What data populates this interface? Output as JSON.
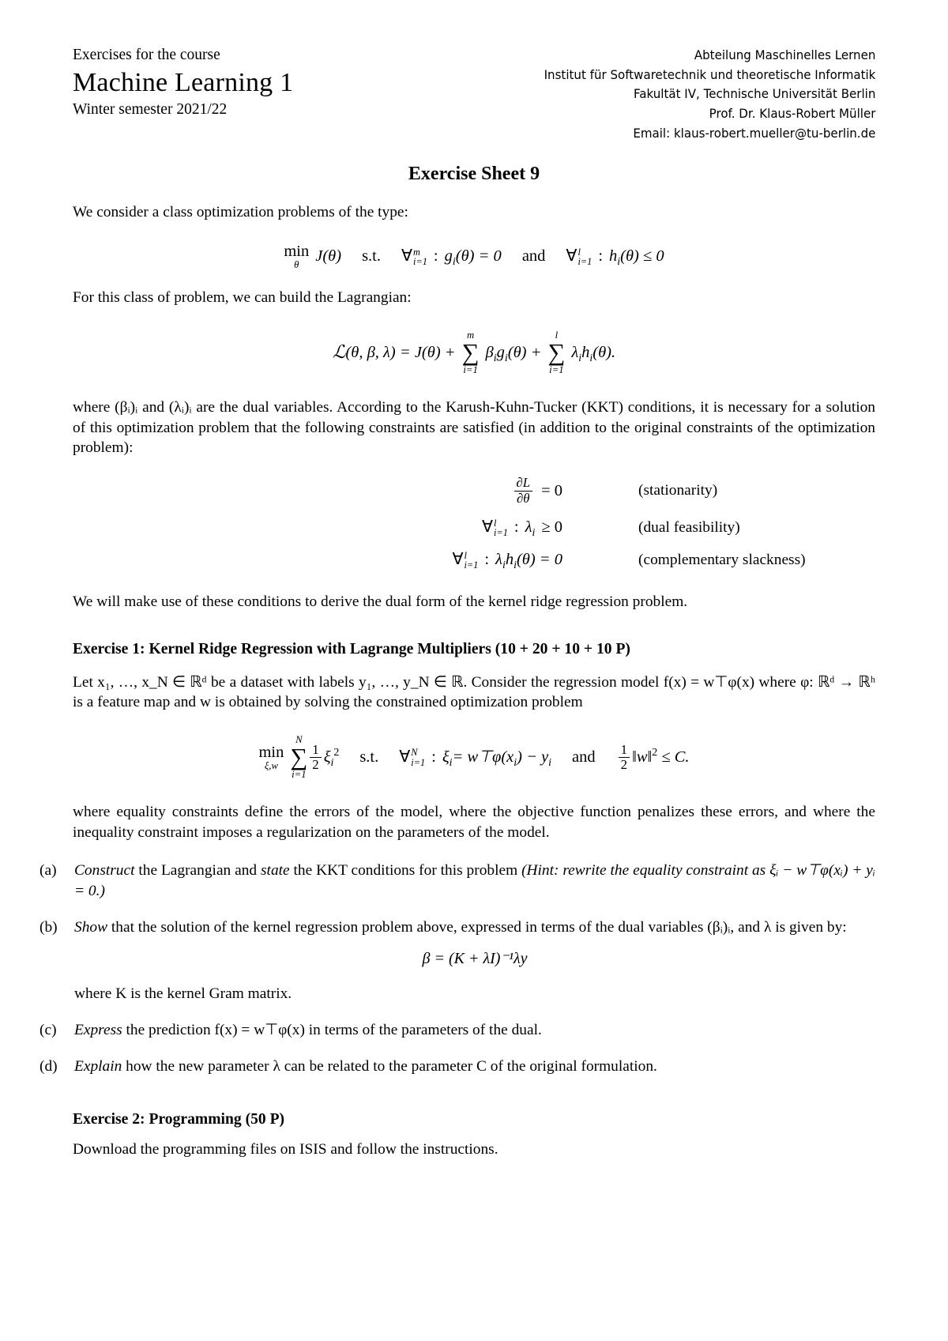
{
  "header": {
    "left": {
      "line1": "Exercises for the course",
      "line2": "Machine Learning 1",
      "line3": "Winter semester 2021/22"
    },
    "right": [
      "Abteilung Maschinelles Lernen",
      "Institut für Softwaretechnik und theoretische Informatik",
      "Fakultät IV, Technische Universität Berlin",
      "Prof. Dr. Klaus-Robert Müller",
      "Email: klaus-robert.mueller@tu-berlin.de"
    ]
  },
  "title": "Exercise Sheet 9",
  "intro": {
    "p1": "We consider a class optimization problems of the type:",
    "eq1": {
      "min": "min",
      "min_sub": "θ",
      "obj": "J(θ)",
      "st": "s.t.",
      "forall1_sup": "m",
      "forall1_sub": "i=1",
      "c1": "g",
      "c1_sub": "i",
      "c1_rest": "(θ) = 0",
      "and": "and",
      "forall2_sup": "l",
      "forall2_sub": "i=1",
      "c2": "h",
      "c2_sub": "i",
      "c2_rest": "(θ) ≤ 0"
    },
    "p2": "For this class of problem, we can build the Lagrangian:",
    "eq2": {
      "lhs": "(θ, β, λ) = J(θ) +",
      "sum1_top": "m",
      "sum1_bot": "i=1",
      "term1": "β",
      "term1_sub": "i",
      "term1_mid": "g",
      "term1_sub2": "i",
      "term1_rest": "(θ) +",
      "sum2_top": "l",
      "sum2_bot": "i=1",
      "term2": "λ",
      "term2_sub": "i",
      "term2_mid": "h",
      "term2_sub2": "i",
      "term2_rest": "(θ)."
    },
    "p3": "where (βᵢ)ᵢ and (λᵢ)ᵢ are the dual variables. According to the Karush-Kuhn-Tucker (KKT) conditions, it is necessary for a solution of this optimization problem that the following constraints are satisfied (in addition to the original constraints of the optimization problem):",
    "kkt": [
      {
        "lhs_type": "frac",
        "num": "∂",
        "num_it": "L",
        "den": "∂θ",
        "rest": "= 0",
        "label": "(stationarity)"
      },
      {
        "lhs_type": "forall",
        "sup": "l",
        "sub": "i=1",
        "expr": "λ",
        "expr_sub": "i",
        "expr_rest": "≥ 0",
        "label": "(dual feasibility)"
      },
      {
        "lhs_type": "forall",
        "sup": "l",
        "sub": "i=1",
        "expr": "λ",
        "expr_sub": "i",
        "expr_mid": "h",
        "expr_sub2": "i",
        "expr_rest": "(θ) = 0",
        "label": "(complementary slackness)"
      }
    ],
    "p4": "We will make use of these conditions to derive the dual form of the kernel ridge regression problem."
  },
  "exercise1": {
    "heading": "Exercise 1: Kernel Ridge Regression with Lagrange Multipliers (10 + 20 + 10 + 10 P)",
    "para_a": "Let x₁, …, x_N ∈ ℝᵈ be a dataset with labels y₁, …, y_N ∈ ℝ. Consider the regression model f(x) = w⊤φ(x) where φ: ℝᵈ → ℝʰ is a feature map and w is obtained by solving the constrained optimization problem",
    "eq": {
      "min": "min",
      "min_sub": "ξ,w",
      "sum_top": "N",
      "sum_bot": "i=1",
      "frac_num": "1",
      "frac_den": "2",
      "xi": "ξ",
      "xi_sub": "i",
      "xi_sup": "2",
      "st": "s.t.",
      "forall_sup": "N",
      "forall_sub": "i=1",
      "constraint": "ξ",
      "constraint_sub": "i",
      "constraint_rest": "= w⊤φ(x",
      "constraint_sub2": "i",
      "constraint_end": ") − y",
      "constraint_sub3": "i",
      "and": "and",
      "frac2_num": "1",
      "frac2_den": "2",
      "norm": "‖w‖",
      "norm_sup": "2",
      "norm_rest": "≤ C."
    },
    "para_b": "where equality constraints define the errors of the model, where the objective function penalizes these errors, and where the inequality constraint imposes a regularization on the parameters of the model.",
    "items": [
      {
        "label": "(a)",
        "text_1": "Construct",
        "text_2": " the Lagrangian and ",
        "text_3": "state",
        "text_4": " the KKT conditions for this problem ",
        "hint": "(Hint: rewrite the equality constraint as ξᵢ − w⊤φ(xᵢ) + yᵢ = 0.)"
      },
      {
        "label": "(b)",
        "text_1": "Show",
        "text_2": " that the solution of the kernel regression problem above, expressed in terms of the dual variables (βᵢ)ᵢ, and λ is given by:",
        "equation": "β = (K + λI)⁻¹λy",
        "after": "where K is the kernel Gram matrix."
      },
      {
        "label": "(c)",
        "text_1": "Express",
        "text_2": " the prediction f(x) = w⊤φ(x) in terms of the parameters of the dual."
      },
      {
        "label": "(d)",
        "text_1": "Explain",
        "text_2": " how the new parameter λ can be related to the parameter C of the original formulation."
      }
    ]
  },
  "exercise2": {
    "heading": "Exercise 2: Programming (50 P)",
    "text": "Download the programming files on ISIS and follow the instructions."
  }
}
